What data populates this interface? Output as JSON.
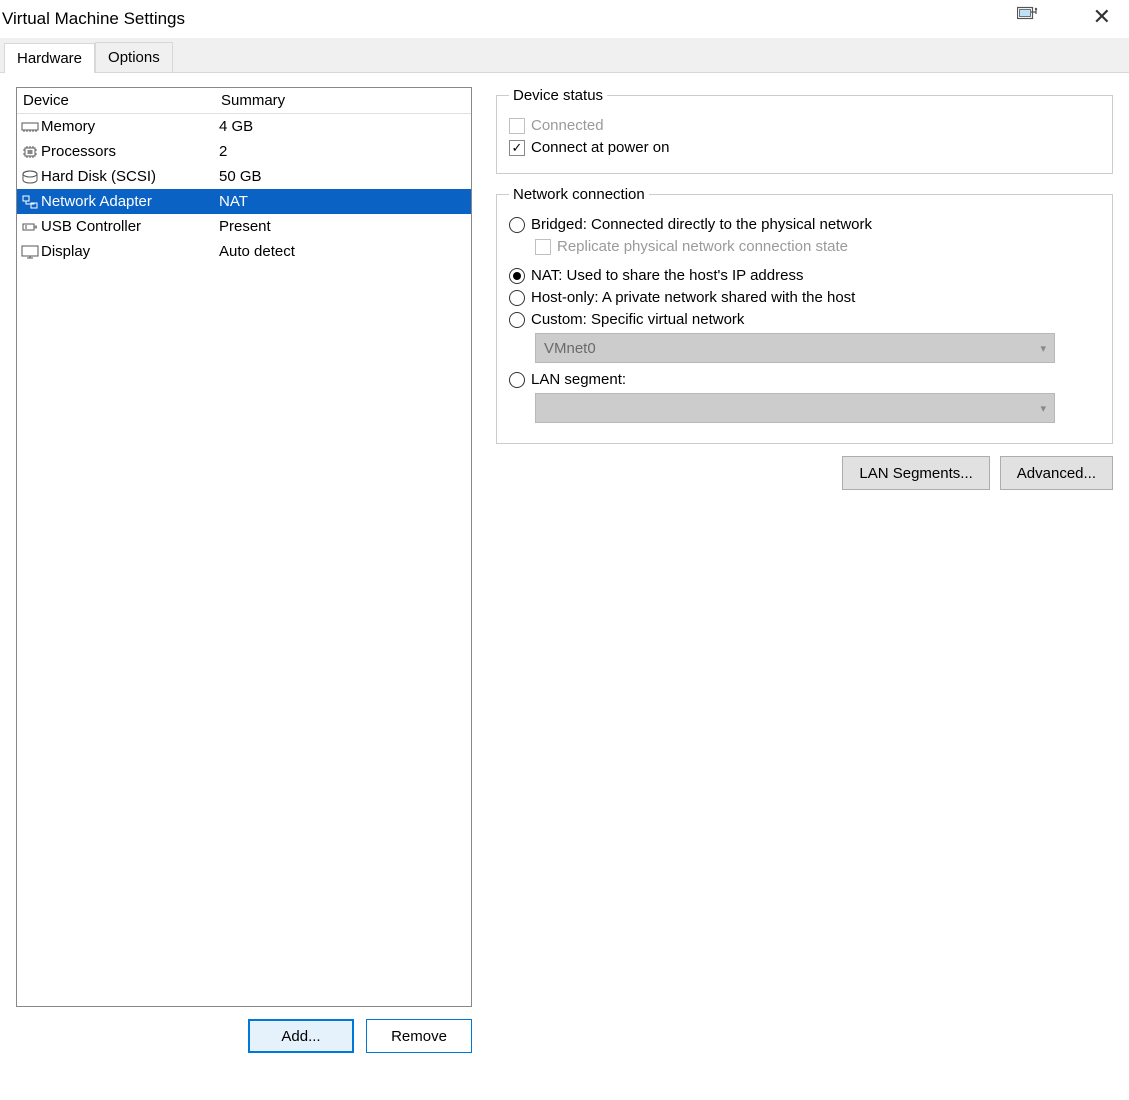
{
  "window": {
    "title": "Virtual Machine Settings"
  },
  "tabs": {
    "hardware": "Hardware",
    "options": "Options"
  },
  "device_list": {
    "col_device": "Device",
    "col_summary": "Summary",
    "rows": [
      {
        "icon": "memory",
        "name": "Memory",
        "summary": "4 GB"
      },
      {
        "icon": "cpu",
        "name": "Processors",
        "summary": "2"
      },
      {
        "icon": "disk",
        "name": "Hard Disk (SCSI)",
        "summary": "50 GB"
      },
      {
        "icon": "network",
        "name": "Network Adapter",
        "summary": "NAT"
      },
      {
        "icon": "usb",
        "name": "USB Controller",
        "summary": "Present"
      },
      {
        "icon": "display",
        "name": "Display",
        "summary": "Auto detect"
      }
    ],
    "selected_index": 3
  },
  "buttons": {
    "add": "Add...",
    "remove": "Remove",
    "lan_segments": "LAN Segments...",
    "advanced": "Advanced..."
  },
  "device_status": {
    "legend": "Device status",
    "connected": "Connected",
    "connected_checked": false,
    "connected_enabled": false,
    "connect_at_power_on": "Connect at power on",
    "connect_at_power_on_checked": true
  },
  "network_connection": {
    "legend": "Network connection",
    "bridged": "Bridged: Connected directly to the physical network",
    "replicate": "Replicate physical network connection state",
    "replicate_enabled": false,
    "nat": "NAT: Used to share the host's IP address",
    "host_only": "Host-only: A private network shared with the host",
    "custom": "Custom: Specific virtual network",
    "custom_select": "VMnet0",
    "lan_segment": "LAN segment:",
    "lan_select": "",
    "selected": "nat"
  }
}
